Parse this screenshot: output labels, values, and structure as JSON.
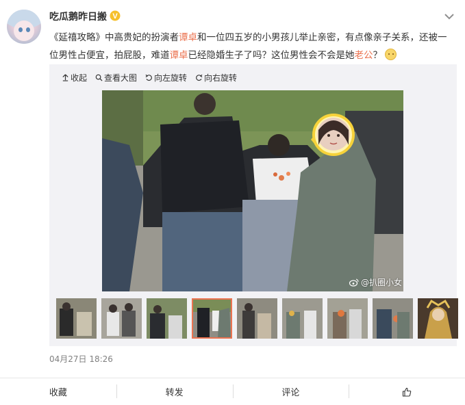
{
  "post": {
    "username": "吃瓜鹅昨日搬",
    "verified_badge": "V",
    "text_parts": {
      "p1": "《延禧攻略》中高贵妃的扮演者",
      "name1": "谭卓",
      "p2": "和一位四五岁的小男孩儿举止亲密，有点像亲子关系，还被一位男性占便宜，拍屁股，难道",
      "name2": "谭卓",
      "p3": "已经隐婚生子了吗？这位男性会不会是她",
      "hl3": "老公",
      "p4": "？"
    },
    "emoji": "doge-emoji",
    "timestamp": "04月27日 18:26"
  },
  "toolbar": {
    "collapse": "收起",
    "view_large": "查看大图",
    "rotate_left": "向左旋转",
    "rotate_right": "向右旋转"
  },
  "media": {
    "watermark": "@扒圈小女",
    "thumbnail_count": 9,
    "active_thumbnail_index": 3
  },
  "actions": {
    "favorite": "收藏",
    "repost": "转发",
    "comment": "评论",
    "like_icon": "thumbs-up-icon"
  },
  "colors": {
    "highlight": "#eb7350",
    "badge": "#f6c02b",
    "text": "#333333",
    "muted": "#808080",
    "media_bg": "#f2f2f5"
  }
}
